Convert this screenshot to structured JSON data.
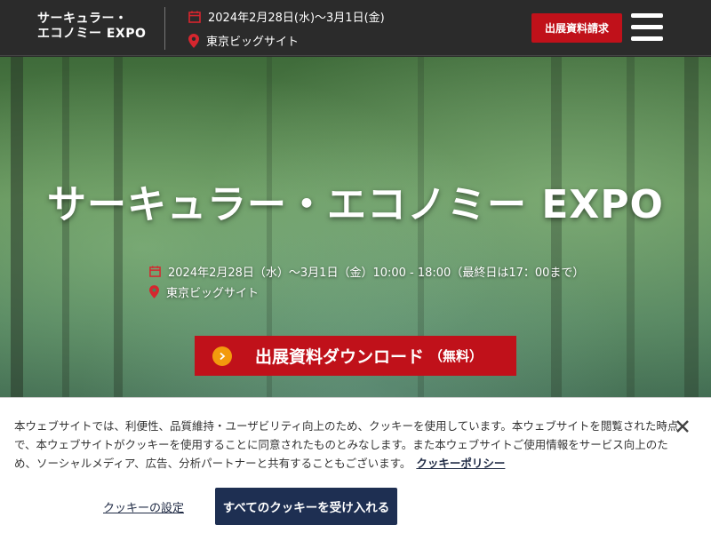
{
  "header": {
    "logo_line1": "サーキュラー・",
    "logo_line2": "エコノミー EXPO",
    "date": "2024年2月28日(水)～3月1日(金)",
    "venue": "東京ビッグサイト",
    "request_button": "出展資料請求",
    "menu_icon": "hamburger-menu-icon"
  },
  "hero": {
    "title": "サーキュラー・エコノミー EXPO",
    "date": "2024年2月28日（水）～3月1日（金）10:00 - 18:00（最終日は17：00まで）",
    "venue": "東京ビッグサイト",
    "download_label": "出展資料ダウンロード",
    "download_suffix": "（無料）"
  },
  "cookie": {
    "text": "本ウェブサイトでは、利便性、品質維持・ユーザビリティ向上のため、クッキーを使用しています。本ウェブサイトを閲覧された時点で、本ウェブサイトがクッキーを使用することに同意されたものとみなします。また本ウェブサイトご使用情報をサービス向上のため、ソーシャルメディア、広告、分析パートナーと共有することもございます。",
    "policy_link": "クッキーポリシー",
    "settings_link": "クッキーの設定",
    "accept_button": "すべてのクッキーを受け入れる"
  },
  "colors": {
    "header_bg": "#2b2b2b",
    "accent_red": "#c0111a",
    "orange": "#f39a0d",
    "navy": "#1e2f52"
  }
}
